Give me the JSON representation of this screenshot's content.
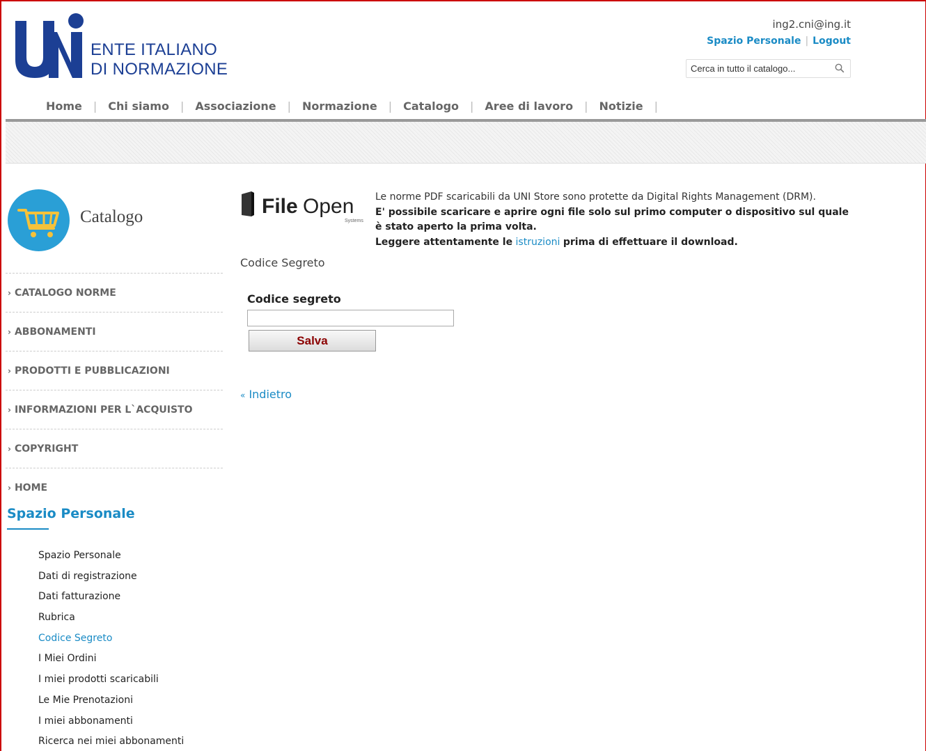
{
  "header": {
    "logo_line1": "ENTE ITALIANO",
    "logo_line2": "DI NORMAZIONE",
    "user_email": "ing2.cni@ing.it",
    "spazio_personale_link": "Spazio Personale",
    "logout_link": "Logout",
    "search_placeholder": "Cerca in tutto il catalogo..."
  },
  "topnav": {
    "items": [
      {
        "label": "Home"
      },
      {
        "label": "Chi siamo"
      },
      {
        "label": "Associazione"
      },
      {
        "label": "Normazione"
      },
      {
        "label": "Catalogo"
      },
      {
        "label": "Aree di lavoro"
      },
      {
        "label": "Notizie"
      }
    ],
    "separator": "|"
  },
  "sidebar": {
    "catalog_title": "Catalogo",
    "menu": [
      {
        "label": "CATALOGO NORME"
      },
      {
        "label": "ABBONAMENTI"
      },
      {
        "label": "PRODOTTI E PUBBLICAZIONI"
      },
      {
        "label": "INFORMAZIONI PER L`ACQUISTO"
      },
      {
        "label": "COPYRIGHT"
      },
      {
        "label": "HOME"
      }
    ],
    "chevron": "›",
    "spazio_heading": "Spazio Personale",
    "spazio_items": [
      {
        "label": "Spazio Personale"
      },
      {
        "label": "Dati di registrazione"
      },
      {
        "label": "Dati fatturazione"
      },
      {
        "label": "Rubrica"
      },
      {
        "label": "Codice Segreto"
      },
      {
        "label": "I Miei Ordini"
      },
      {
        "label": "I miei prodotti scaricabili"
      },
      {
        "label": "Le Mie Prenotazioni"
      },
      {
        "label": "I miei abbonamenti"
      },
      {
        "label": "Ricerca nei miei abbonamenti"
      }
    ],
    "active_item": "Codice Segreto"
  },
  "main": {
    "fileopen_bold": "File",
    "fileopen_light": "Open",
    "fileopen_sub": "Systems",
    "drm_line1": "Le norme PDF scaricabili da UNI Store sono protette da Digital Rights Management (DRM).",
    "drm_bold1": "E' possibile scaricare e aprire ogni file solo sul primo computer o dispositivo sul quale è stato aperto la prima volta.",
    "drm_bold2_pre": "Leggere attentamente le",
    "drm_link": "istruzioni",
    "drm_bold2_post": "prima di effettuare il download.",
    "page_label": "Codice Segreto",
    "field_label": "Codice segreto",
    "code_value": "",
    "save_label": "Salva",
    "back_label": "Indietro",
    "back_prefix": "«"
  },
  "colors": {
    "accent": "#1a8bc5",
    "brand_blue": "#1c3f94",
    "button_text": "#8b0000",
    "frame_border": "#cc0000"
  }
}
